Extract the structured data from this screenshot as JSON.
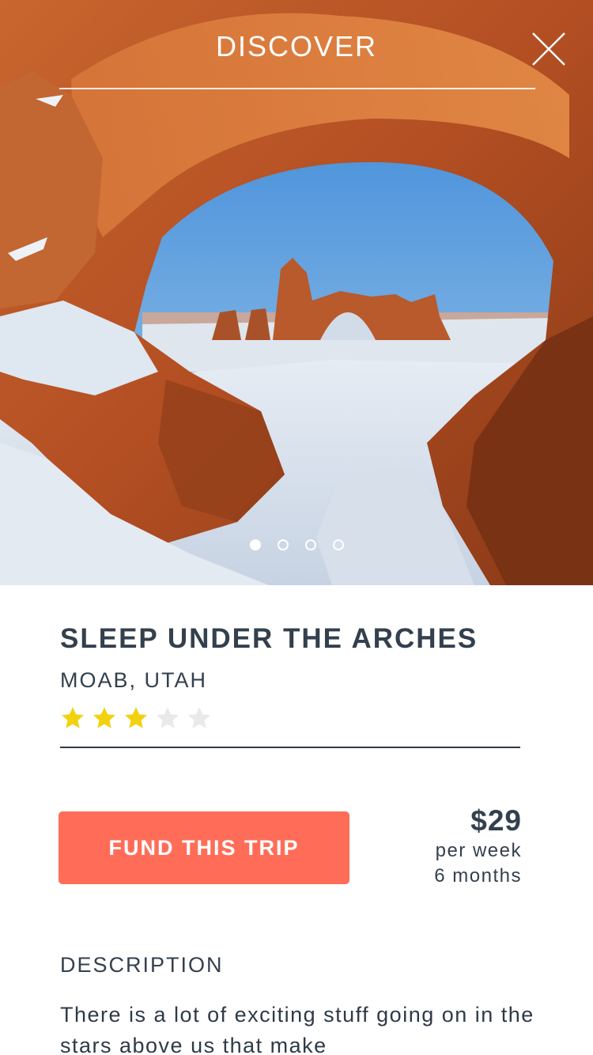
{
  "header": {
    "title": "DISCOVER",
    "close_icon": "close-icon"
  },
  "carousel": {
    "total_slides": 4,
    "active_index": 0
  },
  "trip": {
    "title": "SLEEP UNDER THE ARCHES",
    "location": "MOAB, UTAH",
    "rating": 3,
    "rating_max": 5
  },
  "funding": {
    "button_label": "FUND THIS TRIP",
    "price": "$29",
    "period": "per week",
    "duration": "6 months"
  },
  "description": {
    "heading": "DESCRIPTION",
    "body": "There is a lot of exciting stuff going on in the stars above us that make"
  },
  "colors": {
    "accent": "#ff6d58",
    "text": "#33404d",
    "star_filled": "#f2d20f",
    "star_empty": "#e9e9e9"
  }
}
